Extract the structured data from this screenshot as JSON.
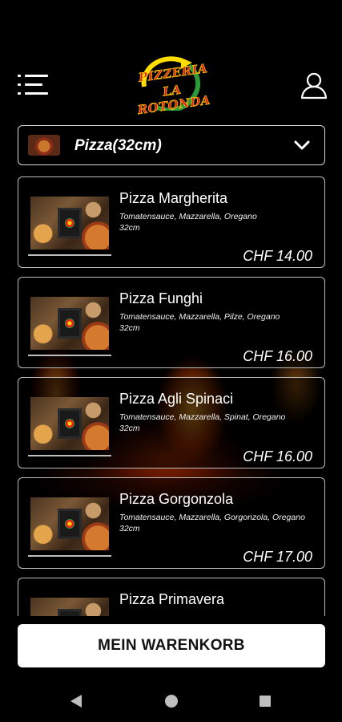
{
  "header": {
    "logo_line1": "PIZZERIA",
    "logo_line2": "LA ROTONDA",
    "menu_icon": "menu-icon",
    "user_icon": "user-icon"
  },
  "category": {
    "selected": "Pizza(32cm)",
    "thumb_icon": "pizza-thumbnail",
    "chevron_icon": "chevron-down-icon"
  },
  "products": [
    {
      "name": "Pizza Margherita",
      "desc": "Tomatensauce, Mazzarella, Oregano",
      "size": "32cm",
      "price": "CHF 14.00"
    },
    {
      "name": "Pizza Funghi",
      "desc": "Tomatensauce, Mazzarella, Pilze, Oregano",
      "size": "32cm",
      "price": "CHF 16.00"
    },
    {
      "name": "Pizza Agli Spinaci",
      "desc": "Tomatensauce, Mazzarella, Spinat, Oregano",
      "size": "32cm",
      "price": "CHF 16.00"
    },
    {
      "name": "Pizza Gorgonzola",
      "desc": "Tomatensauce, Mazzarella, Gorgonzola, Oregano",
      "size": "32cm",
      "price": "CHF 17.00"
    },
    {
      "name": "Pizza Primavera",
      "desc": "",
      "size": "",
      "price": ""
    }
  ],
  "cart": {
    "label": "MEIN WARENKORB"
  },
  "colors": {
    "background": "#000000",
    "card_border": "#bdbdbd",
    "logo_red": "#e0211e",
    "logo_yellow": "#ffde00",
    "logo_green": "#2a9a3a"
  }
}
